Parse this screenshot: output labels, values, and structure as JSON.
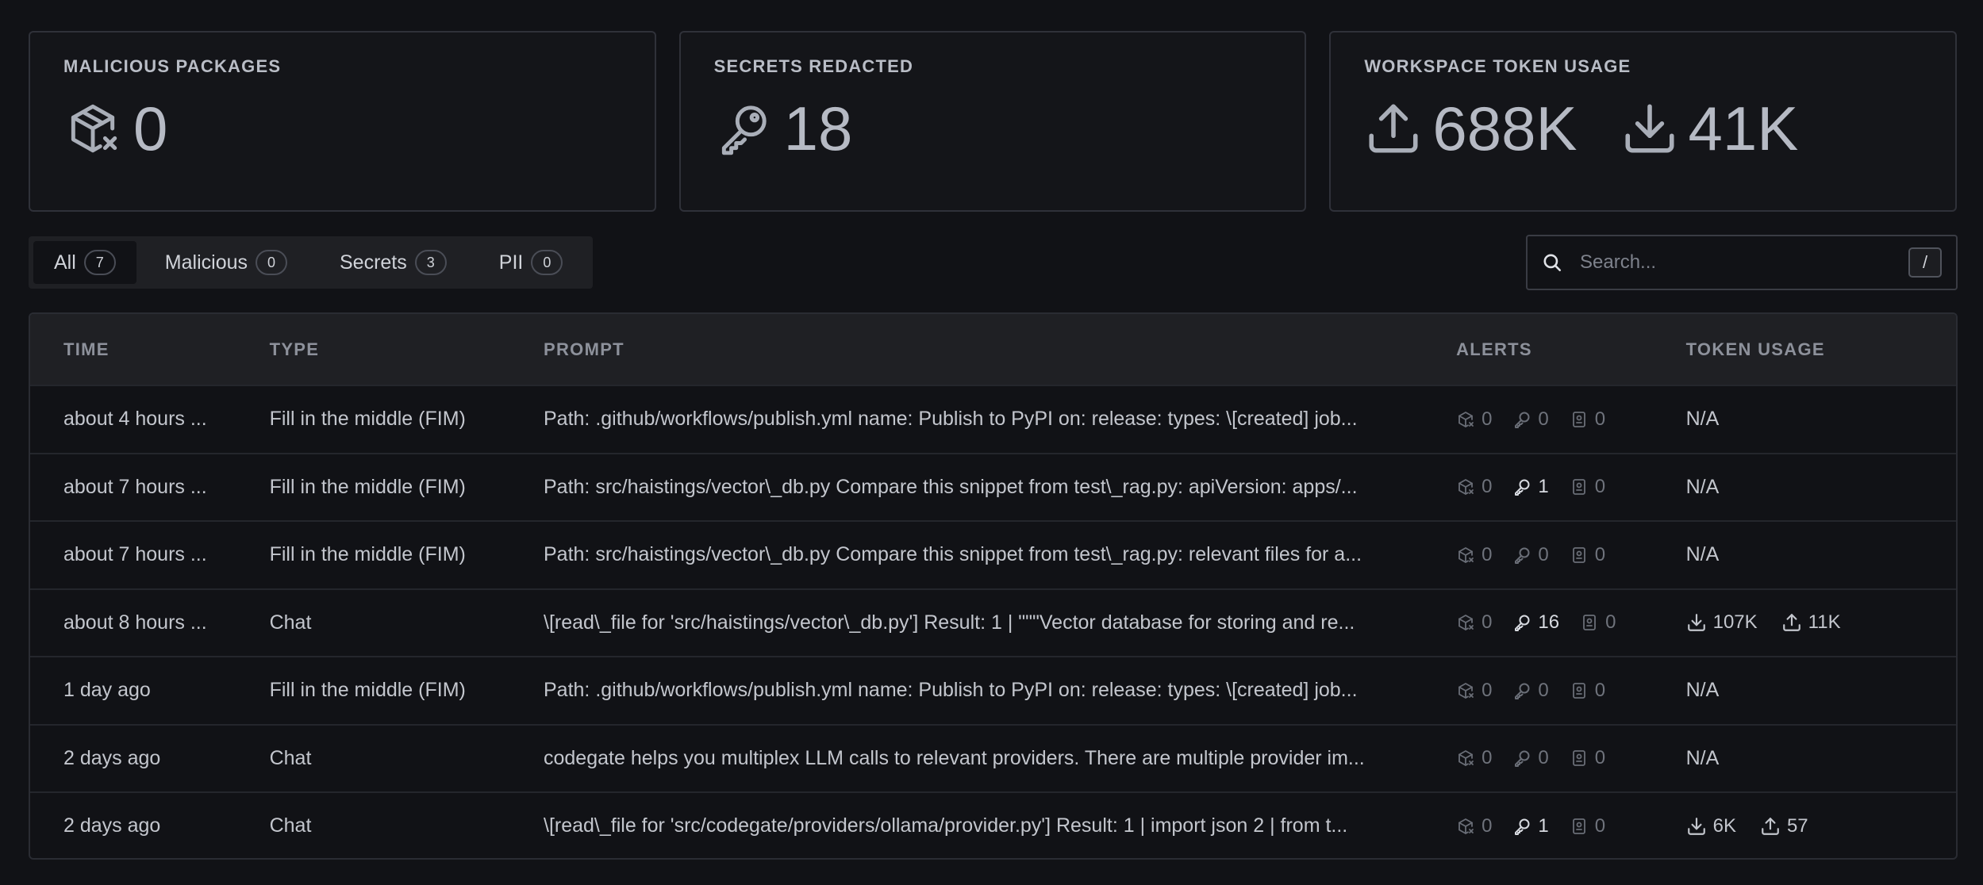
{
  "cards": {
    "malicious": {
      "title": "MALICIOUS PACKAGES",
      "value": "0",
      "icon": "package-x-icon"
    },
    "secrets": {
      "title": "SECRETS REDACTED",
      "value": "18",
      "icon": "key-icon"
    },
    "tokens": {
      "title": "WORKSPACE TOKEN USAGE",
      "upload_value": "688K",
      "download_value": "41K"
    }
  },
  "tabs": [
    {
      "label": "All",
      "count": "7",
      "active": true
    },
    {
      "label": "Malicious",
      "count": "0"
    },
    {
      "label": "Secrets",
      "count": "3"
    },
    {
      "label": "PII",
      "count": "0"
    }
  ],
  "search": {
    "placeholder": "Search...",
    "shortcut": "/"
  },
  "table": {
    "headers": {
      "time": "TIME",
      "type": "TYPE",
      "prompt": "PROMPT",
      "alerts": "ALERTS",
      "usage": "TOKEN USAGE"
    },
    "rows": [
      {
        "time": "about 4 hours ...",
        "type": "Fill in the middle (FIM)",
        "prompt": "Path: .github/workflows/publish.yml name: Publish to PyPI on: release: types: \\[created] job...",
        "malicious": "0",
        "secrets": "0",
        "pii": "0",
        "usage": "N/A"
      },
      {
        "time": "about 7 hours ...",
        "type": "Fill in the middle (FIM)",
        "prompt": "Path: src/haistings/vector\\_db.py Compare this snippet from test\\_rag.py: apiVersion: apps/...",
        "malicious": "0",
        "secrets": "1",
        "pii": "0",
        "usage": "N/A"
      },
      {
        "time": "about 7 hours ...",
        "type": "Fill in the middle (FIM)",
        "prompt": "Path: src/haistings/vector\\_db.py Compare this snippet from test\\_rag.py: relevant files for a...",
        "malicious": "0",
        "secrets": "0",
        "pii": "0",
        "usage": "N/A"
      },
      {
        "time": "about 8 hours ...",
        "type": "Chat",
        "prompt": "\\[read\\_file for 'src/haistings/vector\\_db.py'] Result: 1 | \"\"\"Vector database for storing and re...",
        "malicious": "0",
        "secrets": "16",
        "pii": "0",
        "download": "107K",
        "upload": "11K"
      },
      {
        "time": "1 day ago",
        "type": "Fill in the middle (FIM)",
        "prompt": "Path: .github/workflows/publish.yml name: Publish to PyPI on: release: types: \\[created] job...",
        "malicious": "0",
        "secrets": "0",
        "pii": "0",
        "usage": "N/A"
      },
      {
        "time": "2 days ago",
        "type": "Chat",
        "prompt": "codegate helps you multiplex LLM calls to relevant providers. There are multiple provider im...",
        "malicious": "0",
        "secrets": "0",
        "pii": "0",
        "usage": "N/A"
      },
      {
        "time": "2 days ago",
        "type": "Chat",
        "prompt": "\\[read\\_file for 'src/codegate/providers/ollama/provider.py'] Result: 1 | import json 2 | from t...",
        "malicious": "0",
        "secrets": "1",
        "pii": "0",
        "download": "6K",
        "upload": "57"
      }
    ]
  }
}
